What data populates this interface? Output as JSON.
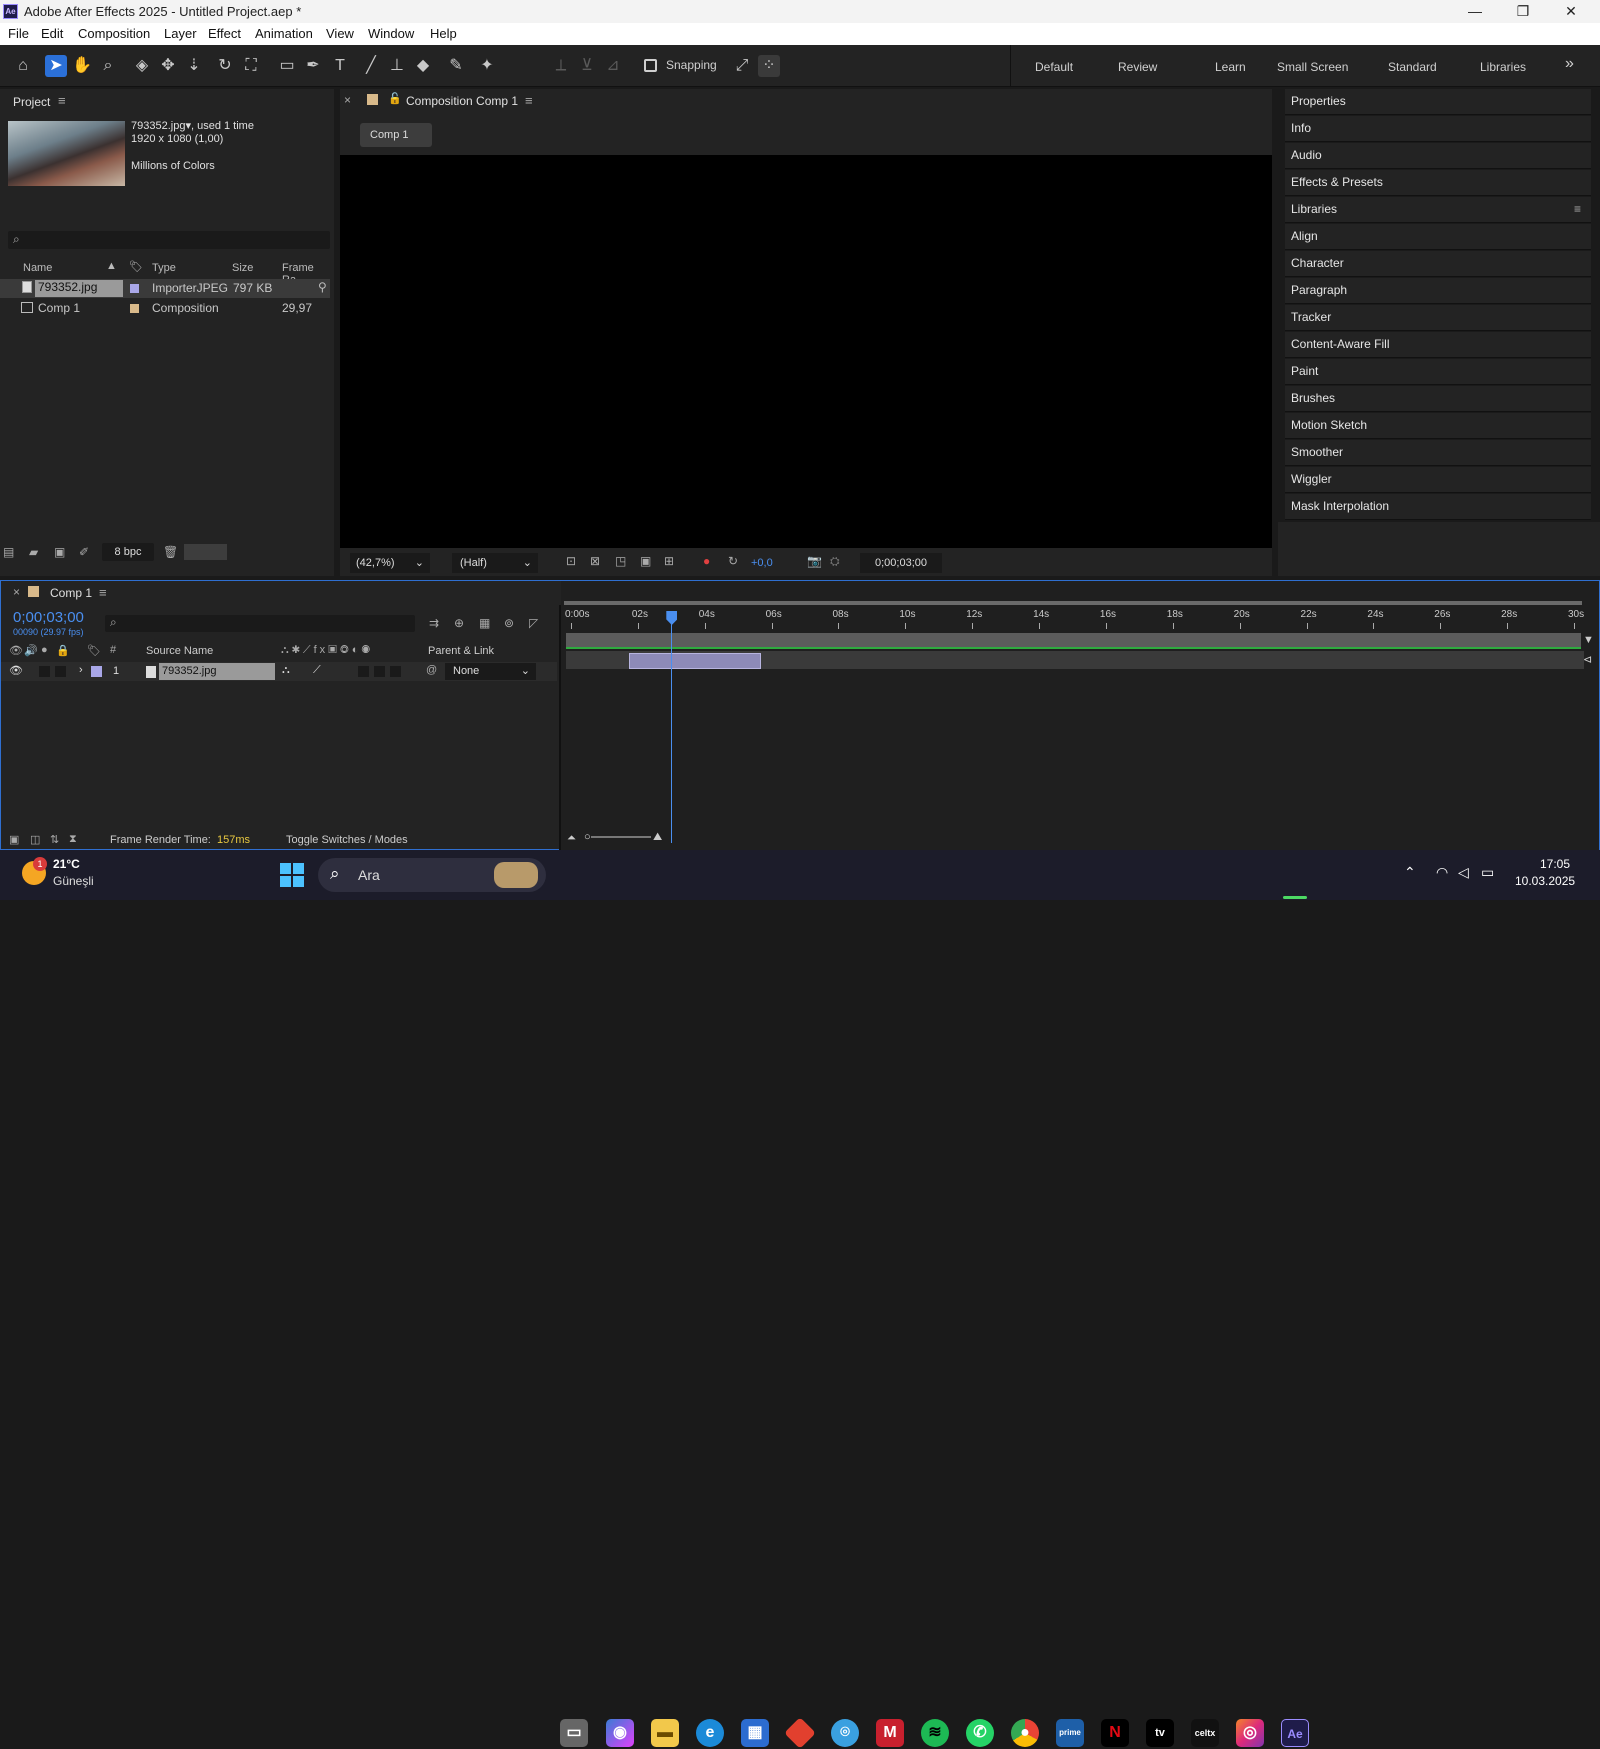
{
  "window": {
    "title": "Adobe After Effects 2025 - Untitled Project.aep *",
    "logo": "Ae",
    "minimize_icon": "—",
    "maximize_icon": "❐",
    "close_icon": "✕"
  },
  "menu": [
    "File",
    "Edit",
    "Composition",
    "Layer",
    "Effect",
    "Animation",
    "View",
    "Window",
    "Help"
  ],
  "toolbar": {
    "snapping_label": "Snapping",
    "workspaces": [
      "Default",
      "Review",
      "Learn",
      "Small Screen",
      "Standard",
      "Libraries"
    ],
    "more_icon": "»"
  },
  "project": {
    "title": "Project",
    "asset_name": "793352.jpg",
    "used": ", used 1 time",
    "dims": "1920 x 1080 (1,00)",
    "colors": "Millions of Colors",
    "search_placeholder": "",
    "columns": [
      "Name",
      "Type",
      "Size",
      "Frame Ra..."
    ],
    "items": [
      {
        "name": "793352.jpg",
        "type": "ImporterJPEG",
        "size": "797 KB",
        "fps": ""
      },
      {
        "name": "Comp 1",
        "type": "Composition",
        "size": "",
        "fps": "29,97"
      }
    ],
    "bpc": "8 bpc"
  },
  "composition": {
    "tab_title": "Composition Comp 1",
    "breadcrumb": "Comp 1",
    "zoom": "(42,7%)",
    "resolution": "(Half)",
    "exposure": "+0,0",
    "timecode": "0;00;03;00"
  },
  "right_panels": [
    "Properties",
    "Info",
    "Audio",
    "Effects & Presets",
    "Libraries",
    "Align",
    "Character",
    "Paragraph",
    "Tracker",
    "Content-Aware Fill",
    "Paint",
    "Brushes",
    "Motion Sketch",
    "Smoother",
    "Wiggler",
    "Mask Interpolation"
  ],
  "timeline": {
    "tab_title": "Comp 1",
    "timecode": "0;00;03;00",
    "frames": "00090 (29.97 fps)",
    "col_source": "Source Name",
    "col_parent": "Parent & Link",
    "col_num": "#",
    "layer_index": "1",
    "layer_name": "793352.jpg",
    "parent_value": "None",
    "ruler": [
      "0:00s",
      "02s",
      "04s",
      "06s",
      "08s",
      "10s",
      "12s",
      "14s",
      "16s",
      "18s",
      "20s",
      "22s",
      "24s",
      "26s",
      "28s",
      "30s"
    ],
    "playhead_seconds": 3,
    "render_time_label": "Frame Render Time:",
    "render_time_value": "157ms",
    "toggle_label": "Toggle Switches / Modes"
  },
  "taskbar": {
    "weather_temp": "21°C",
    "weather_desc": "Güneşli",
    "weather_badge": "1",
    "search_text": "Ara",
    "time": "17:05",
    "date": "10.03.2025"
  }
}
